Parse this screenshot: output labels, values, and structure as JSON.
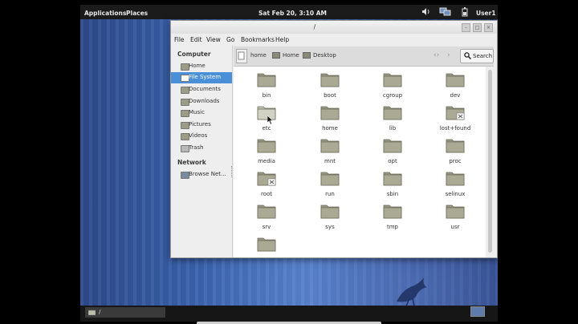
{
  "panel": {
    "applications": "Applications",
    "places": "Places",
    "clock": "Sat Feb 20,  3:10 AM",
    "user": "User1"
  },
  "window": {
    "title": "/",
    "menu": [
      "File",
      "Edit",
      "View",
      "Go",
      "Bookmarks",
      "Help"
    ],
    "sidebar": {
      "computer_header": "Computer",
      "items": [
        "Home",
        "File System",
        "Documents",
        "Downloads",
        "Music",
        "Pictures",
        "Videos",
        "Trash"
      ],
      "network_header": "Network",
      "network_items": [
        "Browse Net..."
      ]
    },
    "toolbar": {
      "path": [
        "home",
        "Home",
        "Desktop"
      ],
      "search_label": "Search"
    },
    "files": [
      {
        "name": "bin",
        "locked": false
      },
      {
        "name": "boot",
        "locked": false
      },
      {
        "name": "cgroup",
        "locked": false
      },
      {
        "name": "dev",
        "locked": false
      },
      {
        "name": "etc",
        "locked": false
      },
      {
        "name": "home",
        "locked": false
      },
      {
        "name": "lib",
        "locked": false
      },
      {
        "name": "lost+found",
        "locked": true
      },
      {
        "name": "media",
        "locked": false
      },
      {
        "name": "mnt",
        "locked": false
      },
      {
        "name": "opt",
        "locked": false
      },
      {
        "name": "proc",
        "locked": false
      },
      {
        "name": "root",
        "locked": true
      },
      {
        "name": "run",
        "locked": false
      },
      {
        "name": "sbin",
        "locked": false
      },
      {
        "name": "selinux",
        "locked": false
      },
      {
        "name": "srv",
        "locked": false
      },
      {
        "name": "sys",
        "locked": false
      },
      {
        "name": "tmp",
        "locked": false
      },
      {
        "name": "usr",
        "locked": false
      },
      {
        "name": "",
        "locked": false
      }
    ],
    "selected_sidebar": "File System",
    "hovered_file": "etc"
  },
  "taskbar": {
    "task_label": "/"
  },
  "colors": {
    "selection": "#4a90d9",
    "folder": "#9c9c86",
    "panel": "#1b1b1b"
  }
}
